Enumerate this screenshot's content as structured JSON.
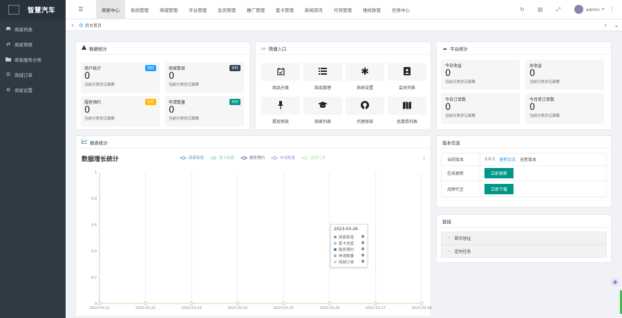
{
  "brand": {
    "name": "智慧汽车",
    "logo_alt": "logo"
  },
  "sidebar": {
    "items": [
      {
        "label": "商家列表",
        "icon": "car-icon"
      },
      {
        "label": "商家审核",
        "icon": "shuffle-icon"
      },
      {
        "label": "商家服务分类",
        "icon": "folder-icon"
      },
      {
        "label": "商城订单",
        "icon": "list-icon"
      },
      {
        "label": "商家设置",
        "icon": "gear-icon"
      }
    ]
  },
  "topnav": {
    "items": [
      "商家中心",
      "系统管理",
      "商城管理",
      "平台管理",
      "会员管理",
      "推广管理",
      "套卡管理",
      "新闻资讯",
      "代驾管理",
      "维修款管",
      "任务中心"
    ],
    "active_index": 0,
    "admin_name": "admin"
  },
  "tabbar": {
    "home_label": "后台首页"
  },
  "data_stats": {
    "title": "数据统计",
    "boxes": [
      {
        "label": "用户统计",
        "value": "0",
        "sub": "当前分类总记录数",
        "badge": "实时",
        "badge_color": "#1e9fff"
      },
      {
        "label": "商家数目",
        "value": "0",
        "sub": "当前分类总记录数",
        "badge": "实时",
        "badge_color": "#2f4056"
      },
      {
        "label": "服务预约",
        "value": "0",
        "sub": "当前分类总记录数",
        "badge": "实时",
        "badge_color": "#ffb800"
      },
      {
        "label": "申请数量",
        "value": "0",
        "sub": "当前分类总记录数",
        "badge": "实时",
        "badge_color": "#009688"
      }
    ]
  },
  "quick_entry": {
    "title": "快捷入口",
    "items": [
      {
        "label": "商品分类",
        "icon": "calendar-check-icon"
      },
      {
        "label": "商品管理",
        "icon": "list-icon"
      },
      {
        "label": "系统设置",
        "icon": "asterisk-icon"
      },
      {
        "label": "会员列表",
        "icon": "contact-icon"
      },
      {
        "label": "提现审核",
        "icon": "pin-icon"
      },
      {
        "label": "商家列表",
        "icon": "graduation-cap-icon"
      },
      {
        "label": "代理审核",
        "icon": "github-icon"
      },
      {
        "label": "优惠券列表",
        "icon": "map-icon"
      }
    ]
  },
  "platform_stats": {
    "title": "平台统计",
    "boxes": [
      {
        "label": "今日收益",
        "value": "0",
        "sub": "当前分类总记录数"
      },
      {
        "label": "总收益",
        "value": "0",
        "sub": "当前分类总记录数"
      },
      {
        "label": "今日订单数",
        "value": "0",
        "sub": "当前分类总记录数"
      },
      {
        "label": "今月单订单数",
        "value": "0",
        "sub": "当前分类总记录数"
      }
    ]
  },
  "report": {
    "title": "报表统计",
    "chart_title": "数据增长统计"
  },
  "chart_data": {
    "type": "line",
    "title": "数据增长统计",
    "xlabel": "",
    "ylabel": "",
    "x": [
      "2023-03-21",
      "2023-03-22",
      "2023-03-23",
      "2023-03-24",
      "2023-03-25",
      "2023-03-26",
      "2023-03-27",
      "2023-03-28"
    ],
    "ylim": [
      0,
      1
    ],
    "yticks": [
      "0",
      "0.2",
      "0.4",
      "0.6",
      "0.8",
      "1"
    ],
    "grid": "vertical",
    "series": [
      {
        "name": "商家新增",
        "color": "#5b9bd5",
        "values": [
          0,
          0,
          0,
          0,
          0,
          0,
          0,
          0
        ]
      },
      {
        "name": "套卡充值",
        "color": "#7fd1c6",
        "values": [
          0,
          0,
          0,
          0,
          0,
          0,
          0,
          0
        ]
      },
      {
        "name": "服务预约",
        "color": "#5f6b8a",
        "values": [
          0,
          0,
          0,
          0,
          0,
          0,
          0,
          0
        ]
      },
      {
        "name": "申请数量",
        "color": "#a99ae0",
        "values": [
          0,
          0,
          0,
          0,
          0,
          0,
          0,
          0
        ]
      },
      {
        "name": "商城订单",
        "color": "#b8e0a6",
        "values": [
          0,
          0,
          0,
          0,
          0,
          0,
          0,
          0
        ]
      }
    ],
    "tooltip": {
      "date": "2023-03-26",
      "rows": [
        {
          "name": "商家新增",
          "value": "0",
          "color": "#5b9bd5"
        },
        {
          "name": "套卡充值",
          "value": "0",
          "color": "#7fd1c6"
        },
        {
          "name": "服务预约",
          "value": "0",
          "color": "#5f6b8a"
        },
        {
          "name": "申请数量",
          "value": "0",
          "color": "#a99ae0"
        },
        {
          "name": "商城订单",
          "value": "0",
          "color": "#b8e0a6"
        }
      ]
    }
  },
  "version": {
    "title": "版本信息",
    "current_label": "当前版本",
    "current_value": "3.0.5",
    "update_log": "更新日志",
    "no_new": "无新版本",
    "online_update_label": "在线更新",
    "online_update_btn": "立即更新",
    "author_label": "品牌代言",
    "author_btn": "立即下载"
  },
  "links": {
    "title": "链接",
    "items": [
      "首页地址",
      "定时任务"
    ]
  }
}
